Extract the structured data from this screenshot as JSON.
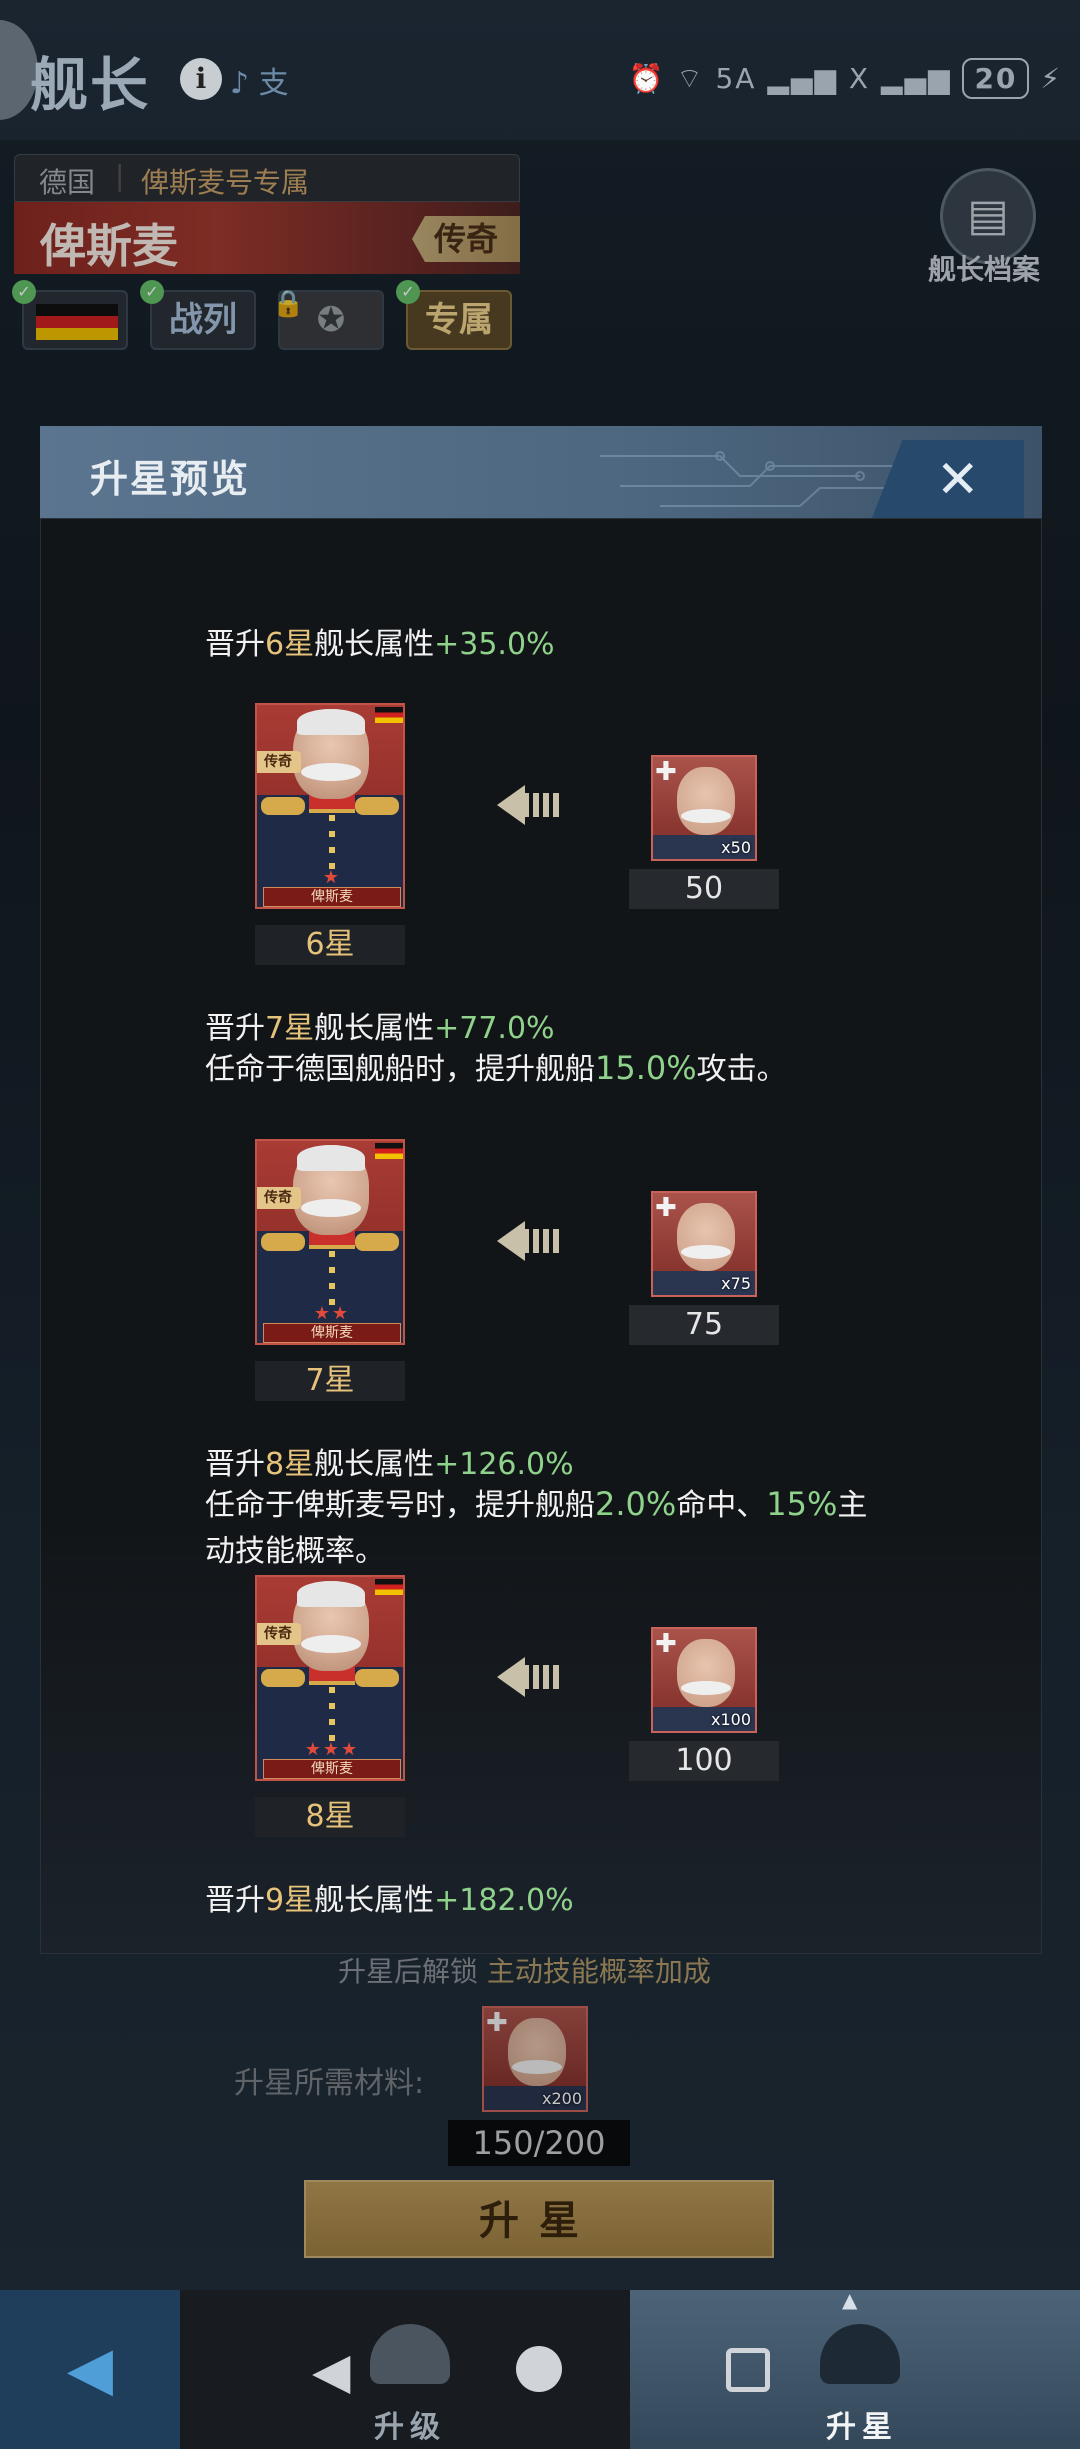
{
  "header": {
    "title": "舰长",
    "status_left": "♪ 支",
    "status_right": "⏰ ⌔ 5A ▂▄▆ X ▂▄▆",
    "battery": "20"
  },
  "captain": {
    "nation": "德国",
    "exclusive": "俾斯麦号专属",
    "name": "俾斯麦",
    "rarity": "传奇",
    "tags": [
      "战列",
      "专属"
    ],
    "archive_label": "舰长档案"
  },
  "modal": {
    "title": "升星预览",
    "levels": [
      {
        "title_prefix": "晋升",
        "star": "6星",
        "title_mid": "舰长属性",
        "bonus": "+35.0%",
        "desc": [],
        "card_name": "俾斯麦",
        "card_rarity": "传奇",
        "card_stars": "★",
        "star_label": "6星",
        "shard_count": "x50",
        "cost": "50"
      },
      {
        "title_prefix": "晋升",
        "star": "7星",
        "title_mid": "舰长属性",
        "bonus": "+77.0%",
        "desc": [
          "任命于德国舰船时，提升舰船",
          "15.0%",
          "攻击。"
        ],
        "card_name": "俾斯麦",
        "card_rarity": "传奇",
        "card_stars": "★★",
        "star_label": "7星",
        "shard_count": "x75",
        "cost": "75"
      },
      {
        "title_prefix": "晋升",
        "star": "8星",
        "title_mid": "舰长属性",
        "bonus": "+126.0%",
        "desc": [
          "任命于俾斯麦号时，提升舰船",
          "2.0%",
          "命中、",
          "15%",
          "主动技能概率。"
        ],
        "card_name": "俾斯麦",
        "card_rarity": "传奇",
        "card_stars": "★★★",
        "star_label": "8星",
        "shard_count": "x100",
        "cost": "100"
      },
      {
        "title_prefix": "晋升",
        "star": "9星",
        "title_mid": "舰长属性",
        "bonus": "+182.0%"
      }
    ]
  },
  "background": {
    "unlock_prefix": "升星后解锁",
    "unlock_value": "主动技能概率加成",
    "materials_label": "升星所需材料:",
    "materials_shard": "x200",
    "materials_count": "150/200",
    "upgrade_button": "升星"
  },
  "nav": {
    "upgrade_label": "升级",
    "star_label": "升星"
  },
  "colors": {
    "accent_gold": "#e6c27a",
    "accent_green": "#8fd28b",
    "header_blue": "#4d6780"
  }
}
